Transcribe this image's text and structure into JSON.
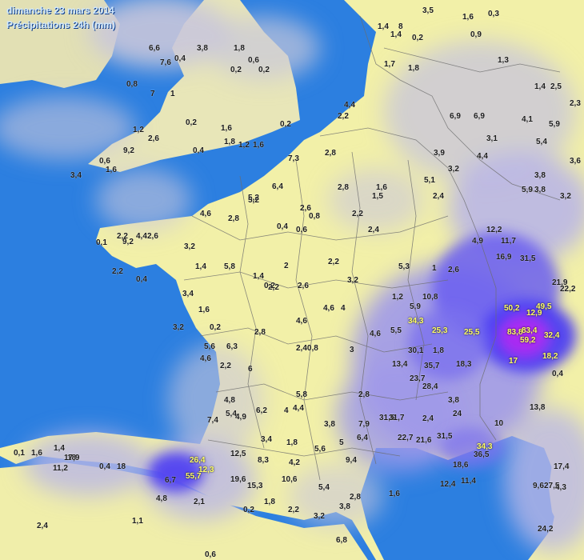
{
  "header": {
    "date": "dimanche 23 mars 2014",
    "product": "Précipitations 24h (mm)"
  },
  "colors": {
    "sea": "#2c7fe0",
    "land_dry": "#f2f0a8",
    "land_wet": "#c9c7da",
    "rain_moderate": "#8c86e6",
    "rain_heavy": "#4b3bf2",
    "rain_extreme": "#b02bf2",
    "border": "#6d6d6d"
  },
  "stations": [
    {
      "v": "1,4"
    },
    {
      "v": "8"
    },
    {
      "v": "1,4"
    },
    {
      "v": "0,2"
    },
    {
      "v": "3,5"
    },
    {
      "v": "1,6"
    },
    {
      "v": "0,9"
    },
    {
      "v": "0,3"
    },
    {
      "v": "6,6"
    },
    {
      "v": "3,8"
    },
    {
      "v": "1,8"
    },
    {
      "v": "0,6"
    },
    {
      "v": "7,6"
    },
    {
      "v": "0,4"
    },
    {
      "v": "0,2"
    },
    {
      "v": "0,2"
    },
    {
      "v": "1,7"
    },
    {
      "v": "1,8"
    },
    {
      "v": "1,3"
    },
    {
      "v": "1,4"
    },
    {
      "v": "2,5"
    },
    {
      "v": "0,8"
    },
    {
      "v": "7"
    },
    {
      "v": "1"
    },
    {
      "v": "0,2"
    },
    {
      "v": "1,6"
    },
    {
      "v": "0,2"
    },
    {
      "v": "1,2"
    },
    {
      "v": "2,6"
    },
    {
      "v": "9,2"
    },
    {
      "v": "1,8"
    },
    {
      "v": "1,2"
    },
    {
      "v": "1,6"
    },
    {
      "v": "0,6"
    },
    {
      "v": "1,6"
    },
    {
      "v": "0,4"
    },
    {
      "v": "3,4"
    },
    {
      "v": "4,4"
    },
    {
      "v": "2,2"
    },
    {
      "v": "6,9"
    },
    {
      "v": "6,9"
    },
    {
      "v": "3,1"
    },
    {
      "v": "4,1"
    },
    {
      "v": "5,9"
    },
    {
      "v": "5,4"
    },
    {
      "v": "2,3"
    },
    {
      "v": "7,3"
    },
    {
      "v": "2,8"
    },
    {
      "v": "5,2"
    },
    {
      "v": "3,9"
    },
    {
      "v": "3,2"
    },
    {
      "v": "4,4"
    },
    {
      "v": "5,1"
    },
    {
      "v": "3,8"
    },
    {
      "v": "3,6"
    },
    {
      "v": "3,8"
    },
    {
      "v": "5,2"
    },
    {
      "v": "6,4"
    },
    {
      "v": "2,8"
    },
    {
      "v": "1,6"
    },
    {
      "v": "4,6"
    },
    {
      "v": "2,8"
    },
    {
      "v": "2,6"
    },
    {
      "v": "0,8"
    },
    {
      "v": "0,4"
    },
    {
      "v": "0,6"
    },
    {
      "v": "2,2"
    },
    {
      "v": "2,4"
    },
    {
      "v": "1,5"
    },
    {
      "v": "2,4"
    },
    {
      "v": "5,9"
    },
    {
      "v": "3,2"
    },
    {
      "v": "2,2"
    },
    {
      "v": "4,4"
    },
    {
      "v": "3,2"
    },
    {
      "v": "0,1"
    },
    {
      "v": "9,2"
    },
    {
      "v": "2,6"
    },
    {
      "v": "12,2"
    },
    {
      "v": "11,7"
    },
    {
      "v": "4,9"
    },
    {
      "v": "2,2"
    },
    {
      "v": "0,4"
    },
    {
      "v": "1,4"
    },
    {
      "v": "5,8"
    },
    {
      "v": "1,4"
    },
    {
      "v": "2"
    },
    {
      "v": "2,2"
    },
    {
      "v": "2,2"
    },
    {
      "v": "5,3"
    },
    {
      "v": "0,2"
    },
    {
      "v": "2,6"
    },
    {
      "v": "3,2"
    },
    {
      "v": "1"
    },
    {
      "v": "2,6"
    },
    {
      "v": "16,9"
    },
    {
      "v": "31,5"
    },
    {
      "v": "21,9"
    },
    {
      "v": "22,2"
    },
    {
      "v": "3,4"
    },
    {
      "v": "1,6"
    },
    {
      "v": "4,6"
    },
    {
      "v": "4"
    },
    {
      "v": "1,2"
    },
    {
      "v": "5,9"
    },
    {
      "v": "10,8"
    },
    {
      "v": "3,2"
    },
    {
      "v": "0,2"
    },
    {
      "v": "2,8"
    },
    {
      "v": "4,6"
    },
    {
      "v": "4,6"
    },
    {
      "v": "5,5"
    },
    {
      "v": "34,3"
    },
    {
      "v": "25,3"
    },
    {
      "v": "25,5"
    },
    {
      "v": "50,2"
    },
    {
      "v": "12,9"
    },
    {
      "v": "49,5"
    },
    {
      "v": "83,8"
    },
    {
      "v": "83,4"
    },
    {
      "v": "59,2"
    },
    {
      "v": "32,4"
    },
    {
      "v": "5,6"
    },
    {
      "v": "6,3"
    },
    {
      "v": "2,40,8"
    },
    {
      "v": "3"
    },
    {
      "v": "13,4"
    },
    {
      "v": "30,1"
    },
    {
      "v": "1,8"
    },
    {
      "v": "35,7"
    },
    {
      "v": "18,3"
    },
    {
      "v": "17"
    },
    {
      "v": "18,2"
    },
    {
      "v": "0,4"
    },
    {
      "v": "4,6"
    },
    {
      "v": "2,2"
    },
    {
      "v": "6"
    },
    {
      "v": "23,7"
    },
    {
      "v": "28,4"
    },
    {
      "v": "5,8"
    },
    {
      "v": "4,4"
    },
    {
      "v": "2,8"
    },
    {
      "v": "3,8"
    },
    {
      "v": "4,8"
    },
    {
      "v": "5,4"
    },
    {
      "v": "6,2"
    },
    {
      "v": "4"
    },
    {
      "v": "3,8"
    },
    {
      "v": "7,9"
    },
    {
      "v": "31,5"
    },
    {
      "v": "31,7"
    },
    {
      "v": "2,4"
    },
    {
      "v": "24"
    },
    {
      "v": "13,8"
    },
    {
      "v": "10"
    },
    {
      "v": "7,4"
    },
    {
      "v": "4,9"
    },
    {
      "v": "3,4"
    },
    {
      "v": "1,8"
    },
    {
      "v": "5,6"
    },
    {
      "v": "5"
    },
    {
      "v": "6,4"
    },
    {
      "v": "22,7"
    },
    {
      "v": "21,6"
    },
    {
      "v": "31,5"
    },
    {
      "v": "34,3"
    },
    {
      "v": "36,5"
    },
    {
      "v": "0,1"
    },
    {
      "v": "1,6"
    },
    {
      "v": "1,4"
    },
    {
      "v": "18"
    },
    {
      "v": "17,9"
    },
    {
      "v": "11,2"
    },
    {
      "v": "0,4"
    },
    {
      "v": "18"
    },
    {
      "v": "12,5"
    },
    {
      "v": "26,4"
    },
    {
      "v": "8,3"
    },
    {
      "v": "4,2"
    },
    {
      "v": "9,4"
    },
    {
      "v": "18,6"
    },
    {
      "v": "17,4"
    },
    {
      "v": "12,3"
    },
    {
      "v": "55,7"
    },
    {
      "v": "6,7"
    },
    {
      "v": "19,6"
    },
    {
      "v": "15,3"
    },
    {
      "v": "10,6"
    },
    {
      "v": "5,4"
    },
    {
      "v": "2,8"
    },
    {
      "v": "12,4"
    },
    {
      "v": "11,4"
    },
    {
      "v": "27,5"
    },
    {
      "v": "4,8"
    },
    {
      "v": "2,1"
    },
    {
      "v": "0,2"
    },
    {
      "v": "1,8"
    },
    {
      "v": "2,2"
    },
    {
      "v": "3,2"
    },
    {
      "v": "3,8"
    },
    {
      "v": "1,6"
    },
    {
      "v": "1,1"
    },
    {
      "v": "2,4"
    },
    {
      "v": "24,2"
    },
    {
      "v": "6,8"
    },
    {
      "v": "0,6"
    },
    {
      "v": "4,3"
    },
    {
      "v": "9,6"
    }
  ]
}
